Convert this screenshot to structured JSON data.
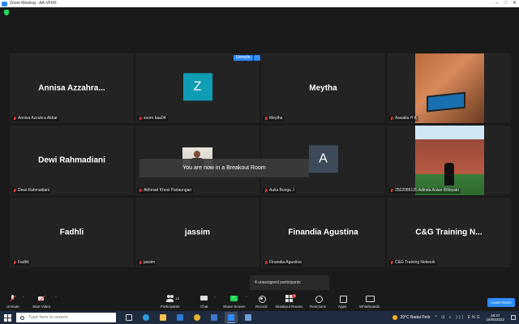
{
  "window": {
    "title": "Zoom Meeting - AA-VFKR"
  },
  "colors": {
    "accent": "#2d8cff",
    "mic_muted": "#e03c3c",
    "share_green": "#23d959",
    "avatar_z": "#0e9db4",
    "avatar_a": "#3d4a5a"
  },
  "unmute_pill": {
    "label": "Unmute",
    "more": "···"
  },
  "tiles": [
    {
      "big_name": "Annisa Azzahra...",
      "label": "Annisa Azzahra Akbar"
    },
    {
      "avatar_letter": "Z",
      "label": "zoom baa04"
    },
    {
      "big_name": "Meytha",
      "label": "Meytha"
    },
    {
      "label": "Aswalia H K"
    },
    {
      "big_name": "Dewi Rahmadiani",
      "label": "Dewi Rahmadiani"
    },
    {
      "label": "Akhmad Khosi Parlaungan"
    },
    {
      "avatar_letter": "A",
      "label": "Aulia Bunga J"
    },
    {
      "label": "2502085125 Adinda Aulan Wiloyatri"
    },
    {
      "big_name": "Fadhli",
      "label": "Fadhli"
    },
    {
      "big_name": "jassim",
      "label": "jassim"
    },
    {
      "big_name": "Finandia Agustina",
      "label": "Finandia Agustina"
    },
    {
      "big_name": "C&G Training N...",
      "label": "C&G Training Network"
    }
  ],
  "toast": "You are now in a Breakout Room",
  "unassigned": "4 unassigned participants",
  "toolbar": {
    "unmute": "Unmute",
    "start_video": "Start Video",
    "participants": "Participants",
    "participants_count": "12",
    "chat": "Chat",
    "share_screen": "Share Screen",
    "record": "Record",
    "breakout_rooms": "Breakout Rooms",
    "breakout_badge": "4",
    "reactions": "Reactions",
    "apps": "Apps",
    "whiteboards": "Whiteboards",
    "leave": "Leave Room"
  },
  "taskbar": {
    "search_placeholder": "Type here to search",
    "weather": "29°C Badai Petir",
    "tray_glyphs": "^ ⊡ ◐ ))) ENG",
    "time": "18:37",
    "date": "18/05/2022"
  }
}
